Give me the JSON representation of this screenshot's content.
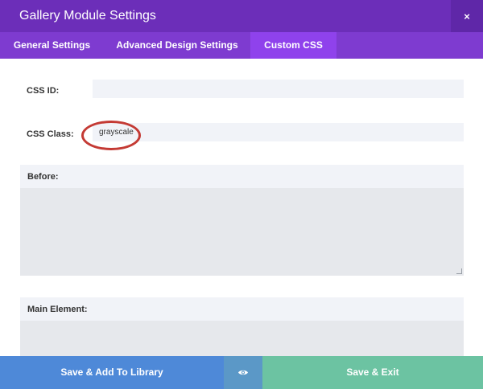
{
  "window": {
    "title": "Gallery Module Settings",
    "close_glyph": "×"
  },
  "tabs": [
    {
      "label": "General Settings",
      "active": false
    },
    {
      "label": "Advanced Design Settings",
      "active": false
    },
    {
      "label": "Custom CSS",
      "active": true
    }
  ],
  "fields": {
    "css_id": {
      "label": "CSS ID:",
      "value": ""
    },
    "css_class": {
      "label": "CSS Class:",
      "value": "grayscale"
    }
  },
  "sections": [
    {
      "label": "Before:",
      "value": ""
    },
    {
      "label": "Main Element:",
      "value": ""
    }
  ],
  "annotation": {
    "color": "#c43a34",
    "target": "css-class-input"
  },
  "footer": {
    "save_library_label": "Save & Add To Library",
    "preview_icon": "eye-icon",
    "save_exit_label": "Save & Exit"
  },
  "colors": {
    "title_bar": "#6c2eb9",
    "tab_bar": "#7e3bd0",
    "tab_active": "#8f42ec",
    "library_button": "#4e89d8",
    "preview_button": "#5b98c7",
    "save_button": "#6cc3a2"
  }
}
